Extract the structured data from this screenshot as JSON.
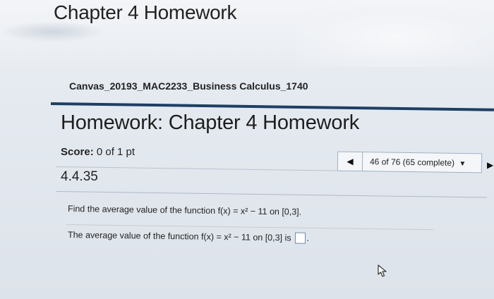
{
  "app": {
    "title": "Chapter 4 Homework"
  },
  "breadcrumb": {
    "course": "Canvas_20193_MAC2233_Business Calculus_1740"
  },
  "header": {
    "title": "Homework: Chapter 4 Homework"
  },
  "score": {
    "label": "Score:",
    "value": "0 of 1 pt"
  },
  "nav": {
    "prev_icon": "triangle-left-icon",
    "status": "46 of 76 (65 complete)",
    "dropdown_icon": "caret-down-icon",
    "next_icon": "triangle-right-icon"
  },
  "question": {
    "id": "4.4.35",
    "prompt": "Find the average value of the function f(x) = x² − 11 on [0,3].",
    "answer_prefix": "The average value of the function f(x) = x² − 11 on [0,3] is",
    "answer_value": "",
    "answer_suffix": "."
  },
  "colors": {
    "header_rule": "#1f3e63",
    "background": "#e4e9f0",
    "nav_border": "#9fb0c3"
  },
  "cursor": {
    "icon": "mouse-pointer-icon"
  }
}
